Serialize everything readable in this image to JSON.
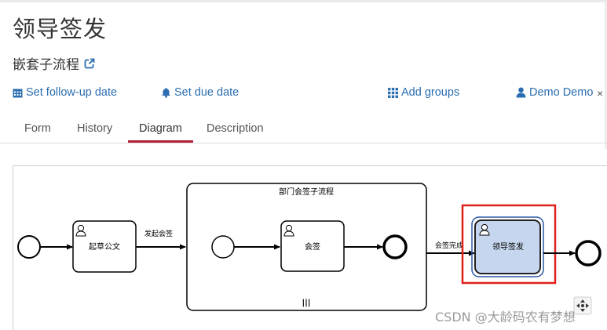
{
  "header": {
    "task_title": "领导签发",
    "process_name": "嵌套子流程",
    "external_link_icon": "external-link-icon"
  },
  "actions": {
    "follow_up": {
      "label": "Set follow-up date",
      "icon": "calendar-icon"
    },
    "due": {
      "label": "Set due date",
      "icon": "bell-icon"
    },
    "groups": {
      "label": "Add groups",
      "icon": "grid-icon"
    },
    "assignee": {
      "label": "Demo Demo",
      "icon": "user-icon",
      "clear": "×"
    }
  },
  "tabs": [
    {
      "label": "Form",
      "active": false
    },
    {
      "label": "History",
      "active": false
    },
    {
      "label": "Diagram",
      "active": true
    },
    {
      "label": "Description",
      "active": false
    }
  ],
  "diagram": {
    "task_draft": "起草公文",
    "flow_initiate": "发起会签",
    "subprocess_title": "部门会签子流程",
    "subprocess_marker": "|||",
    "task_countersign": "会签",
    "flow_complete": "会签完成",
    "task_leader_sign": "领导签发",
    "highlight_color": "#e0201d",
    "active_task_fill": "#c6d6ee",
    "active_task_border": "#2a5aa5"
  },
  "watermark": "CSDN @大龄码农有梦想"
}
